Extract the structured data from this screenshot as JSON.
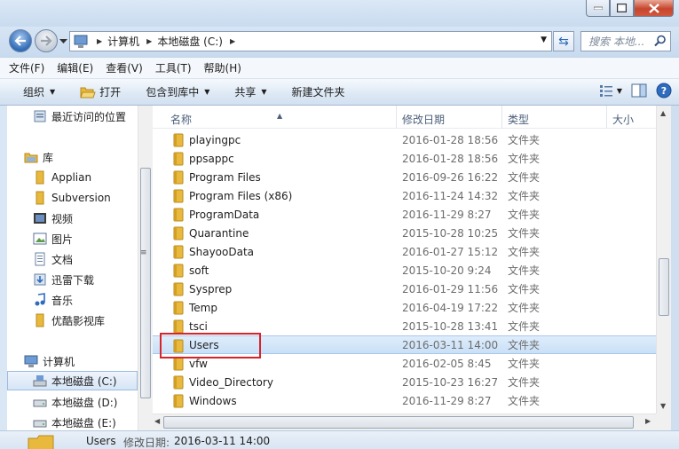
{
  "address": {
    "crumbs": [
      "计算机",
      "本地磁盘 (C:)"
    ],
    "search_placeholder": "搜索 本地..."
  },
  "menu": [
    "文件(F)",
    "编辑(E)",
    "查看(V)",
    "工具(T)",
    "帮助(H)"
  ],
  "toolbar": {
    "organize": "组织",
    "open": "打开",
    "include_library": "包含到库中",
    "share": "共享",
    "new_folder": "新建文件夹"
  },
  "nav": {
    "recent": "最近访问的位置",
    "library": "库",
    "applian": "Applian",
    "subversion": "Subversion",
    "video": "视频",
    "pictures": "图片",
    "documents": "文档",
    "thunder": "迅雷下载",
    "music": "音乐",
    "youku": "优酷影视库",
    "computer": "计算机",
    "drive_c": "本地磁盘 (C:)",
    "drive_d": "本地磁盘 (D:)",
    "drive_e": "本地磁盘 (E:)"
  },
  "columns": {
    "name": "名称",
    "date": "修改日期",
    "type": "类型",
    "size": "大小"
  },
  "files": [
    {
      "name": "playingpc",
      "date": "2016-01-28 18:56",
      "type": "文件夹"
    },
    {
      "name": "ppsappc",
      "date": "2016-01-28 18:56",
      "type": "文件夹"
    },
    {
      "name": "Program Files",
      "date": "2016-09-26 16:22",
      "type": "文件夹"
    },
    {
      "name": "Program Files (x86)",
      "date": "2016-11-24 14:32",
      "type": "文件夹"
    },
    {
      "name": "ProgramData",
      "date": "2016-11-29 8:27",
      "type": "文件夹"
    },
    {
      "name": "Quarantine",
      "date": "2015-10-28 10:25",
      "type": "文件夹"
    },
    {
      "name": "ShayooData",
      "date": "2016-01-27 15:12",
      "type": "文件夹"
    },
    {
      "name": "soft",
      "date": "2015-10-20 9:24",
      "type": "文件夹"
    },
    {
      "name": "Sysprep",
      "date": "2016-01-29 11:56",
      "type": "文件夹"
    },
    {
      "name": "Temp",
      "date": "2016-04-19 17:22",
      "type": "文件夹"
    },
    {
      "name": "tsci",
      "date": "2015-10-28 13:41",
      "type": "文件夹"
    },
    {
      "name": "Users",
      "date": "2016-03-11 14:00",
      "type": "文件夹"
    },
    {
      "name": "vfw",
      "date": "2016-02-05 8:45",
      "type": "文件夹"
    },
    {
      "name": "Video_Directory",
      "date": "2015-10-23 16:27",
      "type": "文件夹"
    },
    {
      "name": "Windows",
      "date": "2016-11-29 8:27",
      "type": "文件夹"
    }
  ],
  "status": {
    "name": "Users",
    "date_label": "修改日期:",
    "date": "2016-03-11 14:00"
  },
  "colors": {
    "selection": "#cce4f8",
    "highlight_box": "#d9232a",
    "folder": "#e8b93c"
  }
}
